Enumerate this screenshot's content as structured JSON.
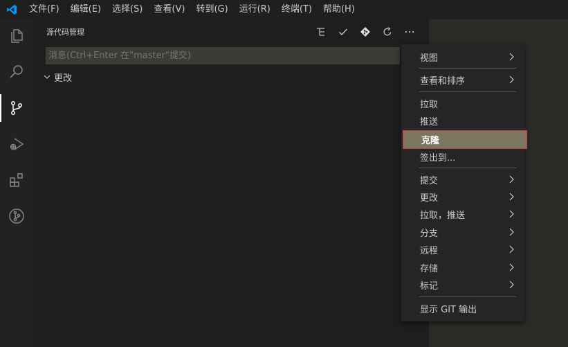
{
  "menubar": {
    "items": [
      "文件(F)",
      "编辑(E)",
      "选择(S)",
      "查看(V)",
      "转到(G)",
      "运行(R)",
      "终端(T)",
      "帮助(H)"
    ]
  },
  "activity_bar": {
    "icons": [
      "files-icon",
      "search-icon",
      "source-control-icon",
      "run-debug-icon",
      "extensions-icon",
      "git-graph-icon"
    ],
    "active": "source-control-icon"
  },
  "sidebar": {
    "title": "源代码管理",
    "commit_placeholder": "消息(Ctrl+Enter 在\"master\"提交)",
    "changes_label": "更改"
  },
  "context_menu": {
    "items": [
      {
        "label": "视图",
        "submenu": true
      },
      {
        "label": "查看和排序",
        "submenu": true
      },
      {
        "label": "拉取",
        "submenu": false
      },
      {
        "label": "推送",
        "submenu": false
      },
      {
        "label": "克隆",
        "submenu": false,
        "highlighted": true
      },
      {
        "label": "签出到...",
        "submenu": false
      },
      {
        "label": "提交",
        "submenu": true
      },
      {
        "label": "更改",
        "submenu": true
      },
      {
        "label": "拉取，推送",
        "submenu": true
      },
      {
        "label": "分支",
        "submenu": true
      },
      {
        "label": "远程",
        "submenu": true
      },
      {
        "label": "存储",
        "submenu": true
      },
      {
        "label": "标记",
        "submenu": true
      },
      {
        "label": "显示 GIT 输出",
        "submenu": false
      }
    ]
  },
  "colors": {
    "accent": "#007acc",
    "highlight_bg": "#7b7660",
    "highlight_border": "#d43b3b"
  }
}
